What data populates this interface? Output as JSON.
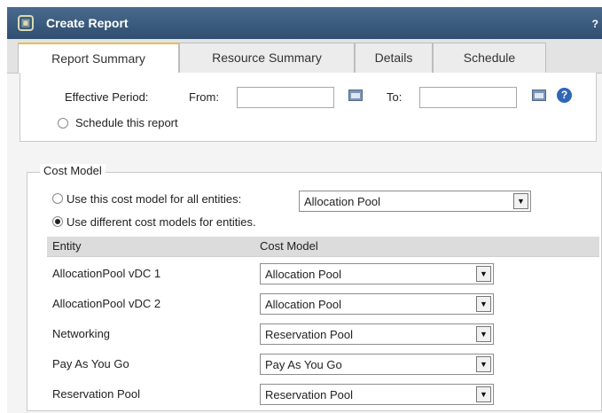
{
  "window": {
    "title": "Create Report",
    "help_glyph": "?"
  },
  "tabs": [
    {
      "label": "Report Summary",
      "active": true
    },
    {
      "label": "Resource Summary",
      "active": false
    },
    {
      "label": "Details",
      "active": false
    },
    {
      "label": "Schedule",
      "active": false
    }
  ],
  "period": {
    "label": "Effective Period:",
    "from_label": "From:",
    "to_label": "To:",
    "from_value": "",
    "to_value": ""
  },
  "schedule": {
    "label": "Schedule this report",
    "checked": false
  },
  "cost_model": {
    "legend": "Cost Model",
    "option_all": {
      "label": "Use this cost model for all entities:",
      "checked": false,
      "select_value": "Allocation Pool"
    },
    "option_different": {
      "label": "Use different cost models for entities.",
      "checked": true
    },
    "columns": [
      "Entity",
      "Cost Model"
    ],
    "rows": [
      {
        "entity": "AllocationPool vDC 1",
        "cost_model": "Allocation Pool"
      },
      {
        "entity": "AllocationPool vDC 2",
        "cost_model": "Allocation Pool"
      },
      {
        "entity": "Networking",
        "cost_model": "Reservation Pool"
      },
      {
        "entity": "Pay As You Go",
        "cost_model": "Pay As You Go"
      },
      {
        "entity": "Reservation Pool",
        "cost_model": "Reservation Pool"
      }
    ]
  },
  "icons": {
    "app": "report-app-icon",
    "calendar": "calendar-icon",
    "help": "help-icon",
    "dropdown": "dropdown-arrow-icon"
  },
  "colors": {
    "titlebar": "#3a5a7e",
    "active_tab_accent": "#e8c04a",
    "help_blue": "#2f66b5"
  }
}
